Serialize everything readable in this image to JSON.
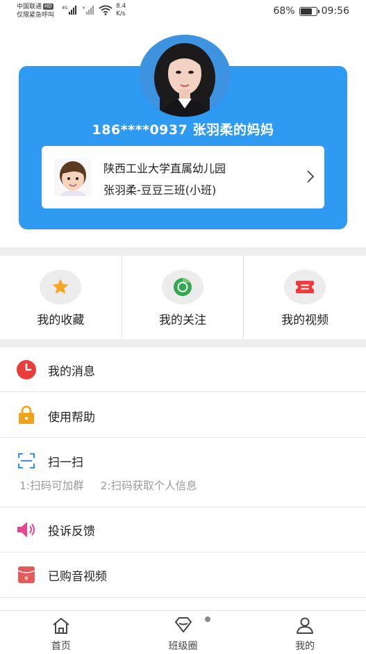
{
  "status_bar": {
    "carrier_line1": "中国联通",
    "hd_badge": "HD",
    "carrier_line2": "仅限紧急呼叫",
    "net_type": "4G",
    "net_speed_value": "8.4",
    "net_speed_unit": "K/s",
    "battery_percent": "68%",
    "battery_level": 0.68,
    "time": "09:56"
  },
  "profile": {
    "phone_and_name": "186****0937 张羽柔的妈妈",
    "school": "陕西工业大学直属幼儿园",
    "class": "张羽柔-豆豆三班(小班)"
  },
  "quick_actions": [
    {
      "label": "我的收藏",
      "icon": "star-icon",
      "color": "#f5a623"
    },
    {
      "label": "我的关注",
      "icon": "chrome-icon",
      "color": "#34a853"
    },
    {
      "label": "我的视频",
      "icon": "ticket-icon",
      "color": "#ef3b3b"
    }
  ],
  "menu": {
    "messages": "我的消息",
    "help": "使用帮助",
    "scan": "扫一扫",
    "scan_hint_1": "1:扫码可加群",
    "scan_hint_2": "2:扫码获取个人信息",
    "feedback": "投诉反馈",
    "purchased": "已购音视频"
  },
  "tabs": [
    {
      "label": "首页",
      "icon": "home-icon"
    },
    {
      "label": "班级圈",
      "icon": "diamond-icon"
    },
    {
      "label": "我的",
      "icon": "user-icon"
    }
  ],
  "colors": {
    "primary_blue": "#2f9af2",
    "clock_red": "#ea3d3a",
    "lock_orange": "#f0a21a",
    "scan_blue": "#3a8ee6",
    "speaker_pink": "#e8448f",
    "purchase_red": "#e35a5a"
  }
}
